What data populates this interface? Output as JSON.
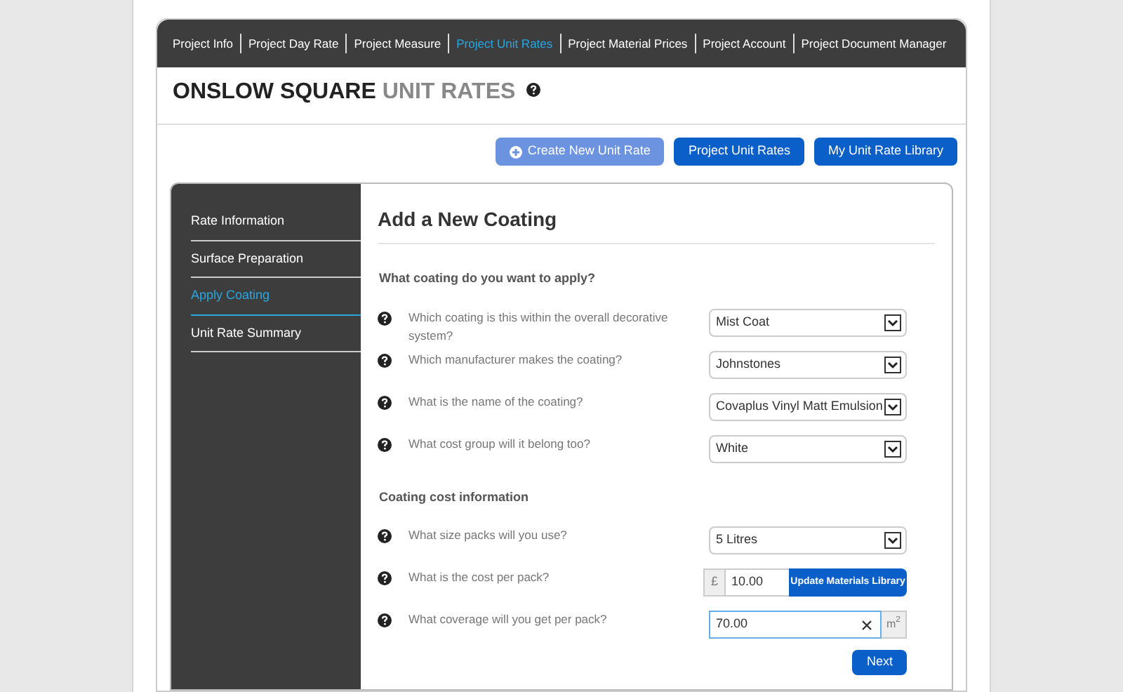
{
  "nav": [
    {
      "label": "Project Info",
      "selected": false
    },
    {
      "label": "Project Day Rate",
      "selected": false
    },
    {
      "label": "Project Measure",
      "selected": false
    },
    {
      "label": "Project Unit Rates",
      "selected": true
    },
    {
      "label": "Project Material Prices",
      "selected": false
    },
    {
      "label": "Project Account",
      "selected": false
    },
    {
      "label": "Project Document Manager",
      "selected": false
    }
  ],
  "title": {
    "main": "ONSLOW SQUARE",
    "sub": "UNIT RATES"
  },
  "actions": [
    {
      "label": "Create New Unit Rate",
      "kind": "create"
    },
    {
      "label": "Project Unit Rates",
      "kind": "primary"
    },
    {
      "label": "My Unit Rate Library",
      "kind": "primary"
    }
  ],
  "steps": [
    {
      "label": "Rate Information",
      "selected": false
    },
    {
      "label": "Surface Preparation",
      "selected": false
    },
    {
      "label": "Apply Coating",
      "selected": true
    },
    {
      "label": "Unit Rate Summary",
      "selected": false
    }
  ],
  "form": {
    "title": "Add a New Coating",
    "sections": [
      {
        "heading": "What coating do you want to apply?",
        "questions": [
          {
            "kind": "select",
            "label": "Which coating is this within the overall decorative system?",
            "value": "Mist Coat"
          },
          {
            "kind": "select",
            "label": "Which manufacturer makes the coating?",
            "value": "Johnstones"
          },
          {
            "kind": "select",
            "label": "What is the name of the coating?",
            "value": "Covaplus Vinyl Matt Emulsion"
          },
          {
            "kind": "select",
            "label": "What cost group will it belong too?",
            "value": "White"
          }
        ]
      },
      {
        "heading": "Coating cost information",
        "questions": [
          {
            "kind": "select",
            "label": "What size packs will you use?",
            "value": "5 Litres"
          },
          {
            "kind": "price",
            "label": "What is the cost per pack?",
            "prefix": "£",
            "value": "10.00",
            "button": "Update Materials Library"
          },
          {
            "kind": "unit",
            "label": "What coverage will you get per pack?",
            "value": "70.00",
            "unit": "m$^{2}$"
          }
        ]
      }
    ],
    "next": "Next"
  }
}
